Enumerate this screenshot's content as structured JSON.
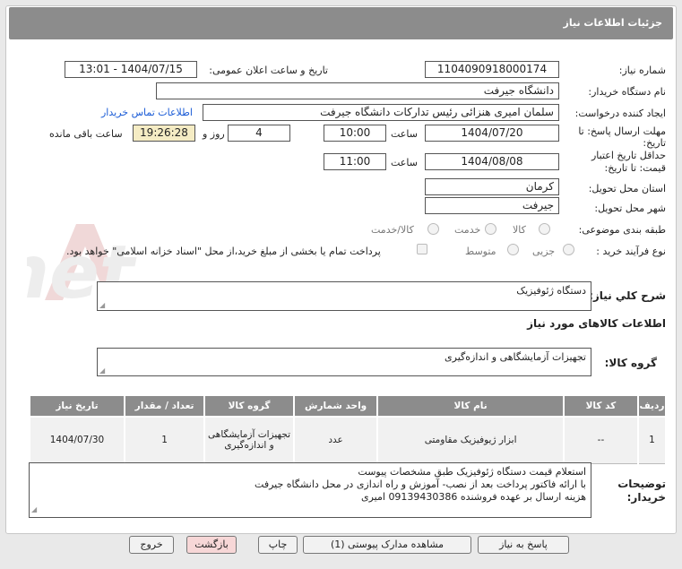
{
  "header": {
    "title": "جزئیات اطلاعات نیاز"
  },
  "fields": {
    "need_number_label": "شماره نیاز:",
    "need_number": "1104090918000174",
    "announce_label": "تاریخ و ساعت اعلان عمومی:",
    "announce_value": "1404/07/15 - 13:01",
    "buyer_label": "نام دستگاه خریدار:",
    "buyer_value": "دانشگاه جیرفت",
    "creator_label": "ایجاد کننده درخواست:",
    "creator_value": "سلمان امیری هنزائی رئیس تدارکات دانشگاه جیرفت",
    "contact_link": "اطلاعات تماس خریدار",
    "deadline_label_1": "مهلت ارسال پاسخ: تا",
    "deadline_label_2": "تاریخ:",
    "deadline_date": "1404/07/20",
    "time_label": "ساعت",
    "deadline_time": "10:00",
    "days_value": "4",
    "days_label": "روز و",
    "remaining_time": "19:26:28",
    "remaining_label": "ساعت باقی مانده",
    "validity_label_1": "حداقل تاریخ اعتبار",
    "validity_label_2": "قیمت: تا تاریخ:",
    "validity_date": "1404/08/08",
    "validity_time": "11:00",
    "province_label": "استان محل تحویل:",
    "province_value": "کرمان",
    "city_label": "شهر محل تحویل:",
    "city_value": "جیرفت",
    "category_label": "طبقه بندی موضوعی:",
    "category_options": [
      "کالا",
      "خدمت",
      "کالا/خدمت"
    ],
    "process_label": "نوع فرآیند خرید :",
    "process_options": [
      "جزیی",
      "متوسط"
    ],
    "payment_note": "پرداخت تمام یا بخشی از مبلغ خرید،از محل \"اسناد خزانه اسلامی\" خواهد بود."
  },
  "summary": {
    "label": "شرح کلي نياز:",
    "value": "دستگاه ژئوفیزیک"
  },
  "goods_section": {
    "title": "اطلاعات کالاهای مورد نیاز",
    "group_label": "گروه کالا:",
    "group_value": "تجهیزات آزمایشگاهی و اندازه‌گیری"
  },
  "table": {
    "headers": [
      "ردیف",
      "کد کالا",
      "نام کالا",
      "واحد شمارش",
      "گروه کالا",
      "تعداد / مقدار",
      "تاریخ نیاز"
    ],
    "rows": [
      [
        "1",
        "--",
        "ابزار ژیوفیزیک مقاومتی",
        "عدد",
        "تجهیزات آزمایشگاهی و اندازه‌گیری",
        "1",
        "1404/07/30"
      ]
    ]
  },
  "notes": {
    "label_1": "توضیحات",
    "label_2": "خریدار:",
    "lines": [
      "استعلام قیمت دستگاه ژئوفیزیک طبق مشخصات پیوست",
      "با ارائه فاکتور پرداخت بعد از نصب- آموزش و راه اندازی در محل دانشگاه جیرفت",
      "هزینه ارسال بر عهده فروشنده 09139430386  امیری"
    ]
  },
  "buttons": {
    "reply": "پاسخ به نیاز",
    "attachments": "مشاهده مدارک پیوستی (1)",
    "print": "چاپ",
    "back": "بازگشت",
    "exit": "خروج"
  }
}
